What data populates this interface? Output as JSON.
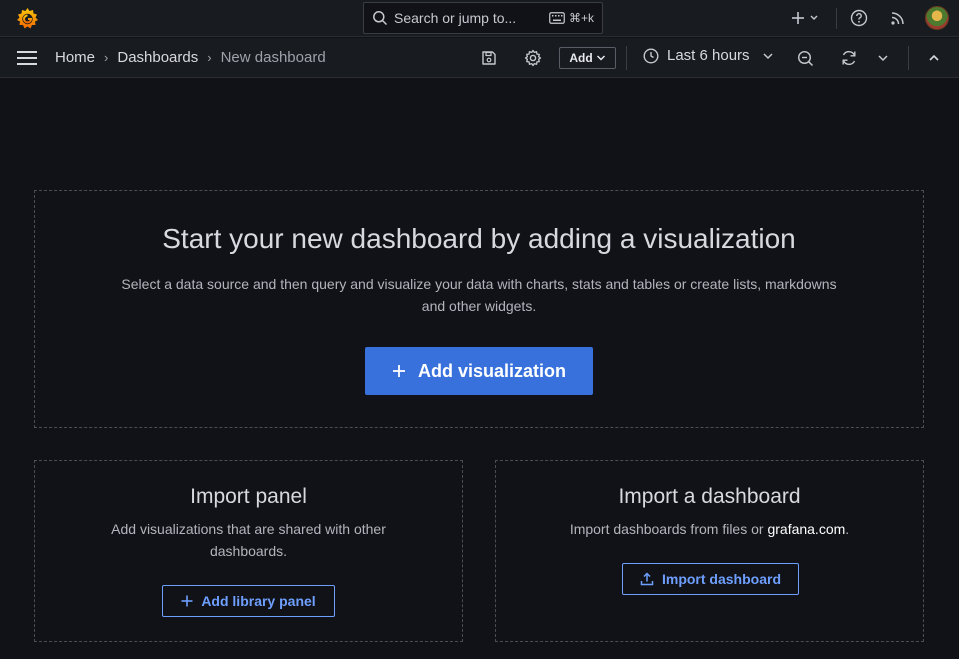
{
  "topbar": {
    "logo_icon": "grafana-logo-icon",
    "search": {
      "placeholder": "Search or jump to...",
      "shortcut": "⌘+k"
    },
    "new_icon": "plus-icon",
    "help_icon": "help-icon",
    "news_icon": "rss-icon",
    "avatar_icon": "user-avatar"
  },
  "navbar": {
    "menu_icon": "hamburger-icon",
    "breadcrumb": [
      "Home",
      "Dashboards",
      "New dashboard"
    ],
    "separator": "›",
    "save_icon": "save-icon",
    "settings_icon": "gear-icon",
    "add_label": "Add",
    "time_range": "Last 6 hours",
    "zoom_out_icon": "zoom-out-icon",
    "refresh_icon": "refresh-icon",
    "collapse_icon": "chevron-up-icon"
  },
  "hero": {
    "title": "Start your new dashboard by adding a visualization",
    "description": "Select a data source and then query and visualize your data with charts, stats and tables or create lists, markdowns and other widgets.",
    "button_label": "Add visualization"
  },
  "import_panel": {
    "title": "Import panel",
    "description": "Add visualizations that are shared with other dashboards.",
    "button_label": "Add library panel"
  },
  "import_dashboard": {
    "title": "Import a dashboard",
    "description_prefix": "Import dashboards from files or ",
    "link_text": "grafana.com",
    "description_suffix": ".",
    "button_label": "Import dashboard"
  },
  "colors": {
    "background": "#111217",
    "bar": "#181b1f",
    "primary": "#3871dc",
    "link_blue": "#6e9fff",
    "brand_orange": "#f46800"
  }
}
